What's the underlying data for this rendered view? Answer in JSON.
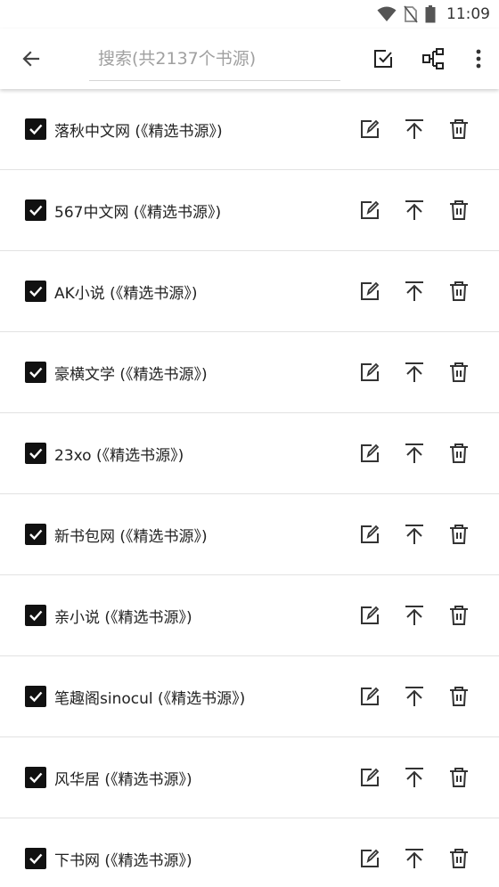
{
  "status_bar": {
    "time": "11:09",
    "icons": [
      "wifi-icon",
      "no-sim-icon",
      "battery-icon"
    ]
  },
  "toolbar": {
    "back_icon": "arrow-left-icon",
    "search_placeholder": "搜索(共2137个书源)",
    "search_value": "",
    "actions": [
      "select-all-icon",
      "group-icon",
      "more-vert-icon"
    ]
  },
  "sources": [
    {
      "name": "落秋中文网 (《精选书源》)",
      "checked": true
    },
    {
      "name": "567中文网 (《精选书源》)",
      "checked": true
    },
    {
      "name": "AK小说 (《精选书源》)",
      "checked": true
    },
    {
      "name": "豪横文学 (《精选书源》)",
      "checked": true
    },
    {
      "name": "23xo (《精选书源》)",
      "checked": true
    },
    {
      "name": "新书包网 (《精选书源》)",
      "checked": true
    },
    {
      "name": "亲小说 (《精选书源》)",
      "checked": true
    },
    {
      "name": "笔趣阁sinocul (《精选书源》)",
      "checked": true
    },
    {
      "name": "风华居 (《精选书源》)",
      "checked": true
    },
    {
      "name": "下书网 (《精选书源》)",
      "checked": true
    }
  ],
  "row_actions": [
    "edit-icon",
    "move-to-top-icon",
    "delete-icon"
  ],
  "colors": {
    "icon": "#333333",
    "checkbox": "#111111",
    "divider": "#e2e2e2",
    "placeholder": "#a0a0a0"
  }
}
